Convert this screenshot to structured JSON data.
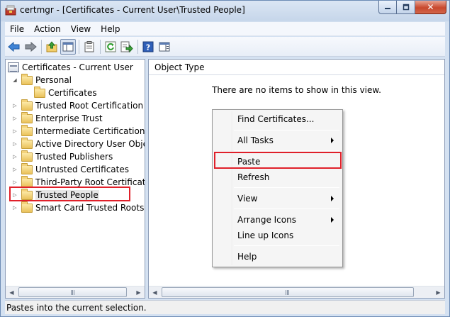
{
  "window": {
    "title": "certmgr - [Certificates - Current User\\Trusted People]",
    "caption_close": "✕"
  },
  "menubar": [
    "File",
    "Action",
    "View",
    "Help"
  ],
  "toolbar": {
    "icons": [
      "back-arrow-icon",
      "forward-arrow-icon",
      "up-folder-icon",
      "show-hide-tree-icon",
      "properties-clipboard-icon",
      "refresh-icon",
      "export-list-icon",
      "help-icon",
      "mmc-view-icon"
    ]
  },
  "tree": {
    "root": "Certificates - Current User",
    "items": [
      {
        "label": "Personal",
        "expander": "◢",
        "level": 1
      },
      {
        "label": "Certificates",
        "expander": "",
        "level": 2
      },
      {
        "label": "Trusted Root Certification Au",
        "expander": "▷",
        "level": 1
      },
      {
        "label": "Enterprise Trust",
        "expander": "▷",
        "level": 1
      },
      {
        "label": "Intermediate Certification Au",
        "expander": "▷",
        "level": 1
      },
      {
        "label": "Active Directory User Object",
        "expander": "▷",
        "level": 1
      },
      {
        "label": "Trusted Publishers",
        "expander": "▷",
        "level": 1
      },
      {
        "label": "Untrusted Certificates",
        "expander": "▷",
        "level": 1
      },
      {
        "label": "Third-Party Root Certification",
        "expander": "▷",
        "level": 1
      },
      {
        "label": "Trusted People",
        "expander": "▷",
        "level": 1,
        "selected": true
      },
      {
        "label": "Smart Card Trusted Roots",
        "expander": "▷",
        "level": 1
      }
    ]
  },
  "list": {
    "column_header": "Object Type",
    "empty_message": "There are no items to show in this view."
  },
  "context_menu": {
    "items": [
      {
        "label": "Find Certificates...",
        "submenu": false
      },
      {
        "label": "All Tasks",
        "submenu": true
      },
      {
        "label": "Paste",
        "submenu": false,
        "highlighted": true
      },
      {
        "label": "Refresh",
        "submenu": false
      },
      {
        "label": "View",
        "submenu": true
      },
      {
        "label": "Arrange Icons",
        "submenu": true
      },
      {
        "label": "Line up Icons",
        "submenu": false
      },
      {
        "label": "Help",
        "submenu": false
      }
    ]
  },
  "status": {
    "text": "Pastes into the current selection."
  },
  "colors": {
    "highlight_box": "#e0202a",
    "window_frame": "#c6d6ea"
  }
}
